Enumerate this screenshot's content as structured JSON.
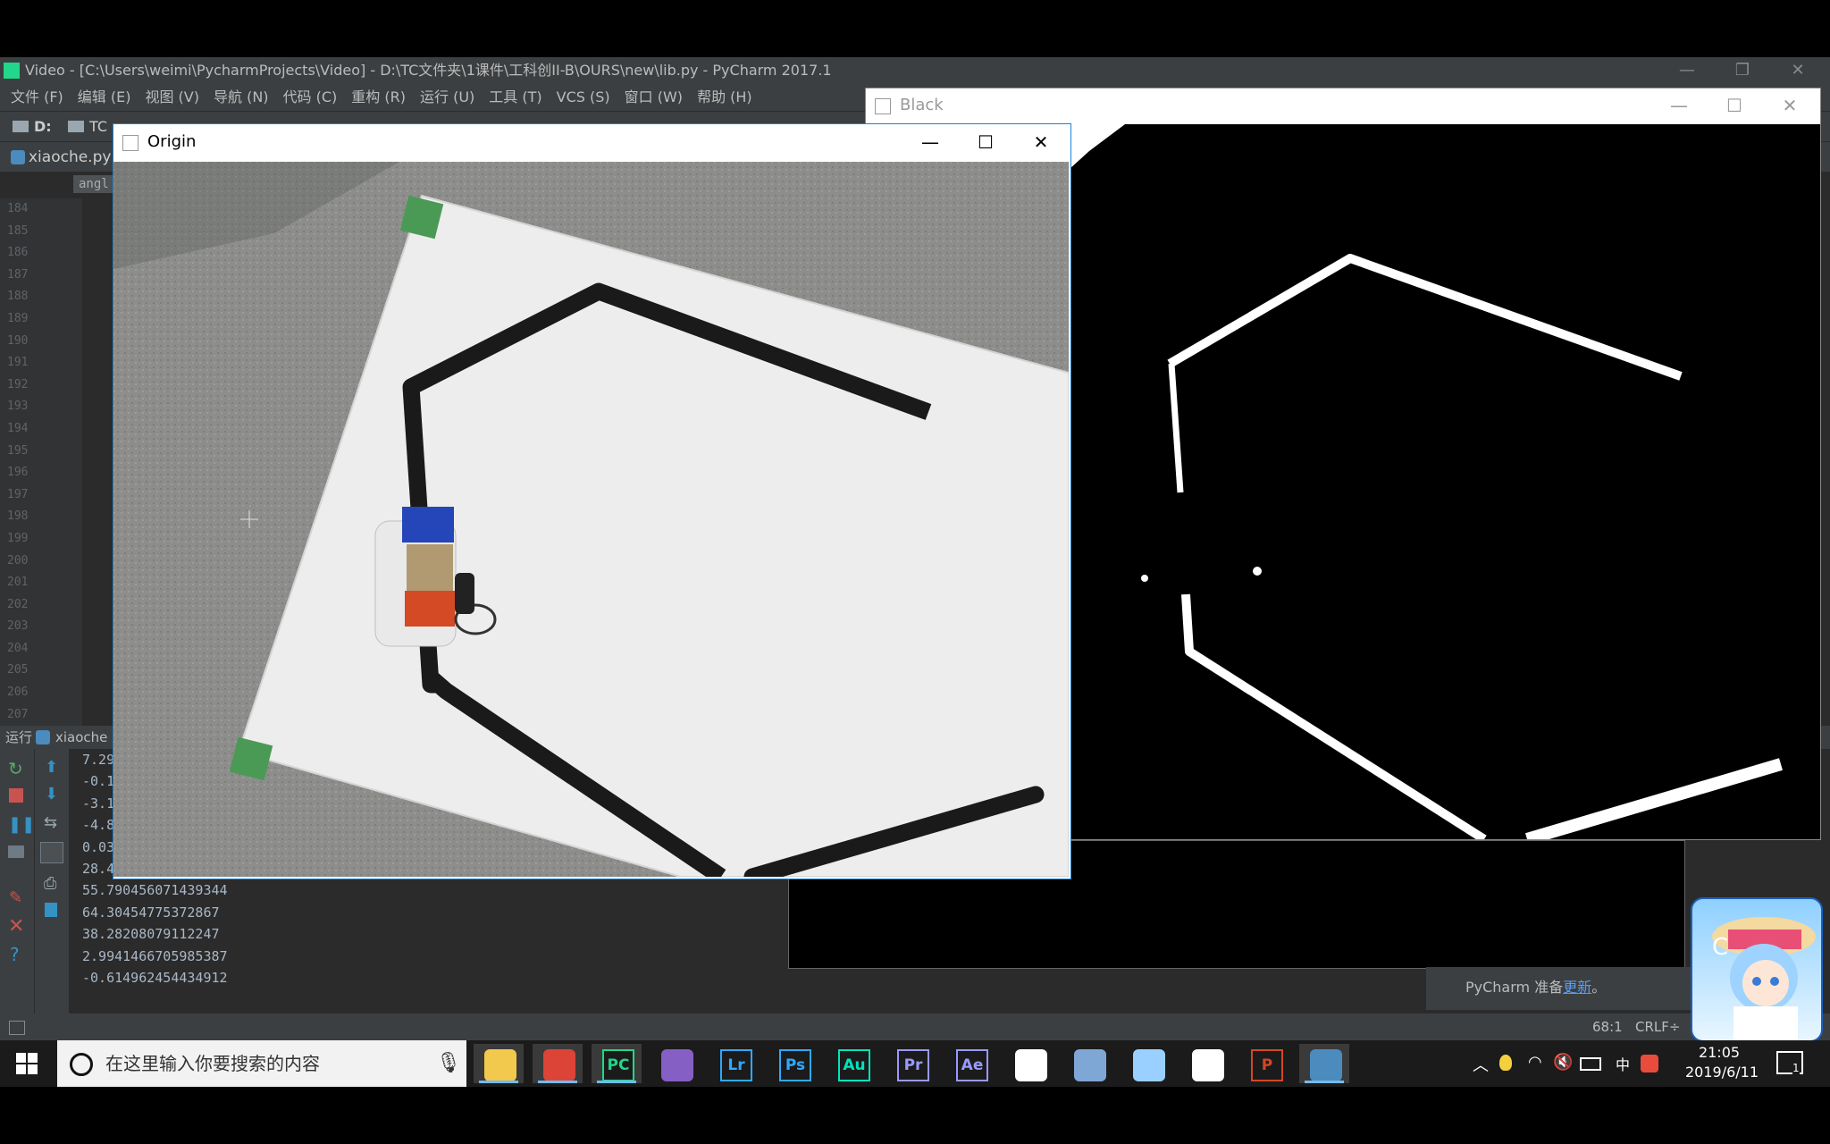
{
  "pycharm": {
    "title": "Video - [C:\\Users\\weimi\\PycharmProjects\\Video] - D:\\TC文件夹\\1课件\\工科创II-B\\OURS\\new\\lib.py - PyCharm 2017.1",
    "menu": [
      "文件 (F)",
      "编辑 (E)",
      "视图 (V)",
      "导航 (N)",
      "代码 (C)",
      "重构 (R)",
      "运行 (U)",
      "工具 (T)",
      "VCS (S)",
      "窗口 (W)",
      "帮助 (H)"
    ],
    "nav": {
      "drive": "D:",
      "folder": "TC"
    },
    "tab": "xiaoche.py",
    "crumb": "angl",
    "line_numbers": [
      "184",
      "185",
      "186",
      "187",
      "188",
      "189",
      "190",
      "191",
      "192",
      "193",
      "194",
      "195",
      "196",
      "197",
      "198",
      "199",
      "200",
      "201",
      "202",
      "203",
      "204",
      "205",
      "206",
      "207"
    ],
    "run_label": "运行",
    "run_config": "xiaoche (",
    "console_lines": [
      "7.29",
      "-0.1",
      "-3.1",
      "-4.8",
      "0.03",
      "28.4",
      "55.790456071439344",
      "64.30454775372867",
      "38.28208079112247",
      "2.9941466705985387",
      "-0.614962454434912"
    ],
    "status": {
      "position": "68:1",
      "line_sep": "CRLF÷"
    },
    "notification": {
      "prefix": "PyCharm 准备",
      "link": "更新",
      "suffix": "。"
    }
  },
  "origin_window": {
    "title": "Origin"
  },
  "black_window": {
    "title": "Black"
  },
  "taskbar": {
    "search_placeholder": "在这里输入你要搜索的内容",
    "apps": [
      {
        "name": "file-explorer",
        "label": "",
        "color": "#f2c94c"
      },
      {
        "name": "chrome",
        "label": "",
        "color": "#db4437"
      },
      {
        "name": "pycharm",
        "label": "PC",
        "color": "#21d789"
      },
      {
        "name": "visual-studio",
        "label": "",
        "color": "#865fc5"
      },
      {
        "name": "lightroom",
        "label": "Lr",
        "color": "#31a8ff"
      },
      {
        "name": "photoshop",
        "label": "Ps",
        "color": "#31a8ff"
      },
      {
        "name": "audition",
        "label": "Au",
        "color": "#00e4bb"
      },
      {
        "name": "premiere",
        "label": "Pr",
        "color": "#9999ff"
      },
      {
        "name": "after-effects",
        "label": "Ae",
        "color": "#9999ff"
      },
      {
        "name": "settings",
        "label": "",
        "color": "#ffffff"
      },
      {
        "name": "network-app",
        "label": "",
        "color": "#7fa7d6"
      },
      {
        "name": "notes-app",
        "label": "",
        "color": "#9ad0ff"
      },
      {
        "name": "clock-app",
        "label": "",
        "color": "#ffffff"
      },
      {
        "name": "powerpoint",
        "label": "P",
        "color": "#d24726"
      },
      {
        "name": "python",
        "label": "",
        "color": "#4b8bbe"
      }
    ],
    "ime": "中",
    "time": "21:05",
    "date": "2019/6/11",
    "notification_count": "1"
  }
}
